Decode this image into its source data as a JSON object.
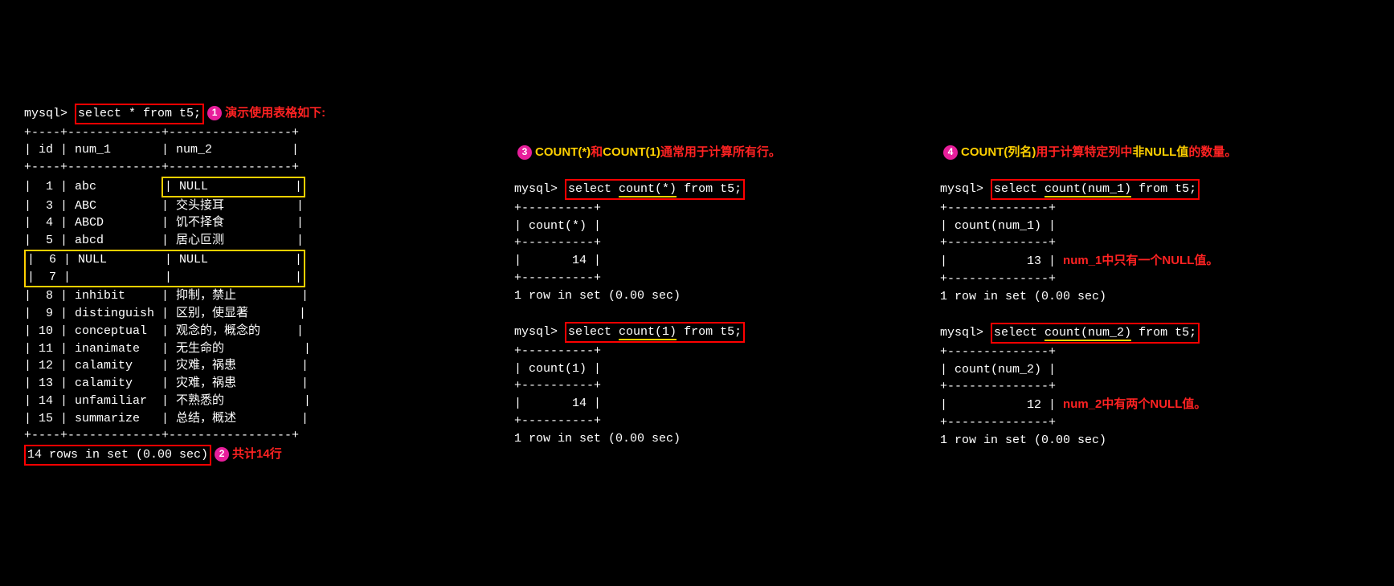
{
  "left": {
    "prompt": "mysql>",
    "query": "select * from t5;",
    "callout1_badge": "1",
    "callout1_text": "演示使用表格如下:",
    "table_border_top": "+----+-------------+-----------------+",
    "table_header": "| id | num_1       | num_2           |",
    "rows": [
      "|  1 | abc         | NULL            |",
      "|  3 | ABC         | 交头接耳          |",
      "|  4 | ABCD        | 饥不择食          |",
      "|  5 | abcd        | 居心叵测          |",
      "|  6 | NULL        | NULL            |",
      "|  7 |             |                 |",
      "|  8 | inhibit     | 抑制，禁止         |",
      "|  9 | distinguish | 区别，使显著       |",
      "| 10 | conceptual  | 观念的，概念的     |",
      "| 11 | inanimate   | 无生命的           |",
      "| 12 | calamity    | 灾难，祸患         |",
      "| 13 | calamity    | 灾难，祸患         |",
      "| 14 | unfamiliar  | 不熟悉的           |",
      "| 15 | summarize   | 总结，概述         |"
    ],
    "summary": "14 rows in set (0.00 sec)",
    "callout2_badge": "2",
    "callout2_text": "共计14行"
  },
  "mid": {
    "callout3_badge": "3",
    "callout3_pre": "COUNT(*)",
    "callout3_mid1": "和",
    "callout3_mid2": "COUNT(1)",
    "callout3_post": "通常用于计算所有行。",
    "prompt": "mysql>",
    "q1_pre": "select ",
    "q1_u": "count(*)",
    "q1_post": " from t5;",
    "sep1": "+----------+",
    "h1": "| count(*) |",
    "v1": "|       14 |",
    "sum1": "1 row in set (0.00 sec)",
    "q2_pre": "select ",
    "q2_u": "count(1)",
    "q2_post": " from t5;",
    "sep2": "+----------+",
    "h2": "| count(1) |",
    "v2": "|       14 |",
    "sum2": "1 row in set (0.00 sec)"
  },
  "right": {
    "callout4_badge": "4",
    "callout4_a": "COUNT(列名)",
    "callout4_b": "用于计算特定列中",
    "callout4_c": "非NULL值",
    "callout4_d": "的数量。",
    "prompt": "mysql>",
    "q1_pre": "select ",
    "q1_u": "count(num_1)",
    "q1_post": " from t5;",
    "sep1": "+--------------+",
    "h1": "| count(num_1) |",
    "v1": "|           13 |",
    "note1": "num_1中只有一个NULL值。",
    "sum1": "1 row in set (0.00 sec)",
    "q2_pre": "select ",
    "q2_u": "count(num_2)",
    "q2_post": " from t5;",
    "sep2": "+--------------+",
    "h2": "| count(num_2) |",
    "v2": "|           12 |",
    "note2": "num_2中有两个NULL值。",
    "sum2": "1 row in set (0.00 sec)"
  }
}
